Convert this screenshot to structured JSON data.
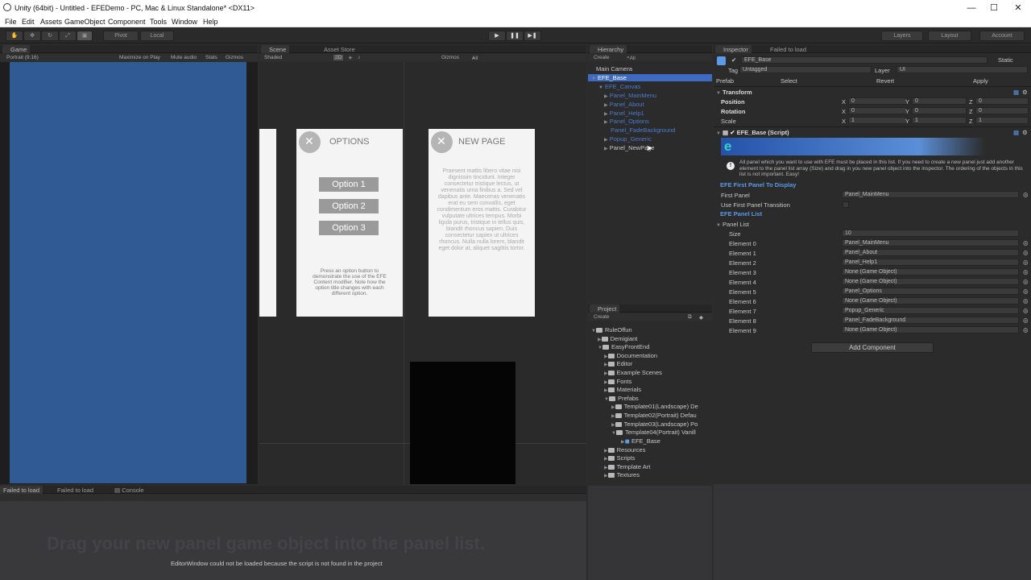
{
  "window": {
    "title": "Unity (64bit) - Untitled - EFEDemo - PC, Mac & Linux Standalone* <DX11>",
    "minimize": "—",
    "maximize": "☐",
    "close": "✕"
  },
  "menu": [
    "File",
    "Edit",
    "Assets",
    "GameObject",
    "Component",
    "Tools",
    "Window",
    "Help"
  ],
  "toolbar": {
    "pivot": "Pivot",
    "local": "Local",
    "layers": "Layers",
    "layout": "Layout",
    "account": "Account"
  },
  "game": {
    "tab": "Game",
    "aspect": "Portrait (9:16)",
    "maximize": "Maximize on Play",
    "mute": "Mute audio",
    "stats": "Stats",
    "gizmos": "Gizmos"
  },
  "scene": {
    "tab": "Scene",
    "store_tab": "Asset Store",
    "shaded": "Shaded",
    "mode2d": "2D",
    "gizmos": "Gizmos",
    "search": "All"
  },
  "options_card": {
    "title": "OPTIONS",
    "options": [
      "Option 1",
      "Option 2",
      "Option 3"
    ],
    "footer": "Press an option button to demonstrate the use of the EFE Content modifier. Note how the option title changes with each different option."
  },
  "newpage_card": {
    "title": "NEW PAGE",
    "body": "Praesent mattis libero vitae nisi dignissim tincidunt. Integer consectetur tristique lectus, ut venenatis urna finibus a. Sed vel dapibus ante. Maecenas venenatis erat eu sem convallis, eget condimentum eros mattis. Curabitur vulputate ultrices tempus. Morbi ligula purus, tristique in tellus quis, blandit rhoncus sapien. Duis consectetur sapien ut ultrices rhoncus. Nulla nulla lorem, blandit eget dolor at, aliquet sagittis tortor."
  },
  "hierarchy": {
    "tab": "Hierarchy",
    "create": "Create",
    "search": "All",
    "items": [
      "Main Camera",
      "EFE_Base",
      "EFE_Canvas",
      "Panel_MainMenu",
      "Panel_About",
      "Panel_Help1",
      "Panel_Options",
      "Panel_FadeBackground",
      "Popup_Generic",
      "Panel_NewPage"
    ]
  },
  "project": {
    "tab": "Project",
    "create": "Create",
    "items": [
      "RuleOffun",
      "Demigiant",
      "EasyFrontEnd",
      "Documentation",
      "Editor",
      "Example Scenes",
      "Fonts",
      "Materials",
      "Prefabs",
      "Template01(Landscape) De",
      "Template02(Portrait) Defau",
      "Template03(Landscape) Po",
      "Template04(Portrait) Vanill",
      "EFE_Base",
      "Resources",
      "Scripts",
      "Template Art",
      "Textures"
    ]
  },
  "inspector": {
    "tab": "Inspector",
    "tab2": "Failed to load",
    "name": "EFE_Base",
    "static": "Static",
    "tag_label": "Tag",
    "tag": "Untagged",
    "layer_label": "Layer",
    "layer": "UI",
    "prefab": "Prefab",
    "select": "Select",
    "revert": "Revert",
    "apply": "Apply",
    "transform": "Transform",
    "position": "Position",
    "rotation": "Rotation",
    "scale": "Scale",
    "x": "X",
    "y": "Y",
    "z": "Z",
    "zero": "0",
    "one": "1",
    "script": "EFE_Base (Script)",
    "info": "All panel which you want to use with EFE must be placed in this list. If you need to create a new panel just add another element to the panel list array (Size) and drag in you new panel object into the inspector. The ordering of the objects in this list is not important. Easy!",
    "first_section": "EFE First Panel To Display",
    "first_panel": "First Panel",
    "first_value": "Panel_MainMenu",
    "use_first": "Use First Panel Transition",
    "list_section": "EFE Panel List",
    "panel_list": "Panel List",
    "size_label": "Size",
    "size": "10",
    "elements": [
      {
        "label": "Element 0",
        "value": "Panel_MainMenu"
      },
      {
        "label": "Element 1",
        "value": "Panel_About"
      },
      {
        "label": "Element 2",
        "value": "Panel_Help1"
      },
      {
        "label": "Element 3",
        "value": "None (Game Object)"
      },
      {
        "label": "Element 4",
        "value": "None (Game Object)"
      },
      {
        "label": "Element 5",
        "value": "Panel_Options"
      },
      {
        "label": "Element 6",
        "value": "None (Game Object)"
      },
      {
        "label": "Element 7",
        "value": "Popup_Generic"
      },
      {
        "label": "Element 8",
        "value": "Panel_FadeBackground"
      },
      {
        "label": "Element 9",
        "value": "None (Game Object)"
      }
    ],
    "add_component": "Add Component"
  },
  "bottom": {
    "tab1": "Failed to load",
    "tab2": "Failed to load",
    "tab3": "Console",
    "overlay": "Drag your new panel game object into the panel list.",
    "message": "EditorWindow could not be loaded because the script is not found in the project"
  },
  "colors": {
    "game_view": "#2f5a94",
    "selection": "#3e6bbf",
    "link": "#4a7bd0"
  }
}
